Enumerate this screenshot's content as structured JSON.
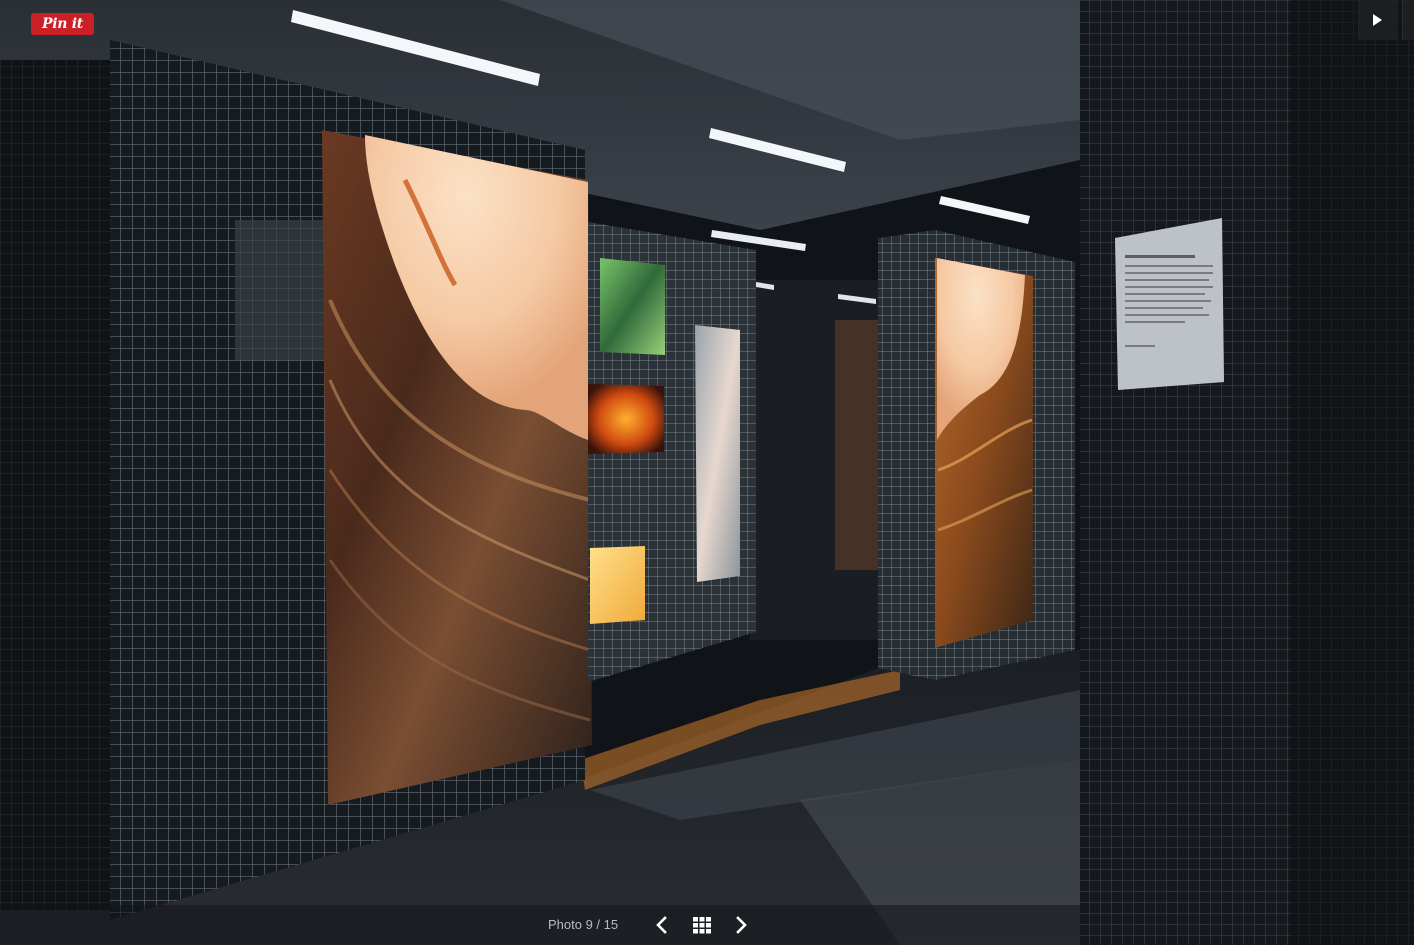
{
  "pin_button": {
    "label": "Pin it"
  },
  "slideshow": {
    "counter": "Photo 9 / 15",
    "current": 9,
    "total": 15
  },
  "icons": {
    "play": "play-icon",
    "prev": "chevron-left-icon",
    "next": "chevron-right-icon",
    "grid": "grid-icon"
  },
  "colors": {
    "pinterest_red": "#cb2027",
    "toolbar_text": "#b8bcc2"
  }
}
